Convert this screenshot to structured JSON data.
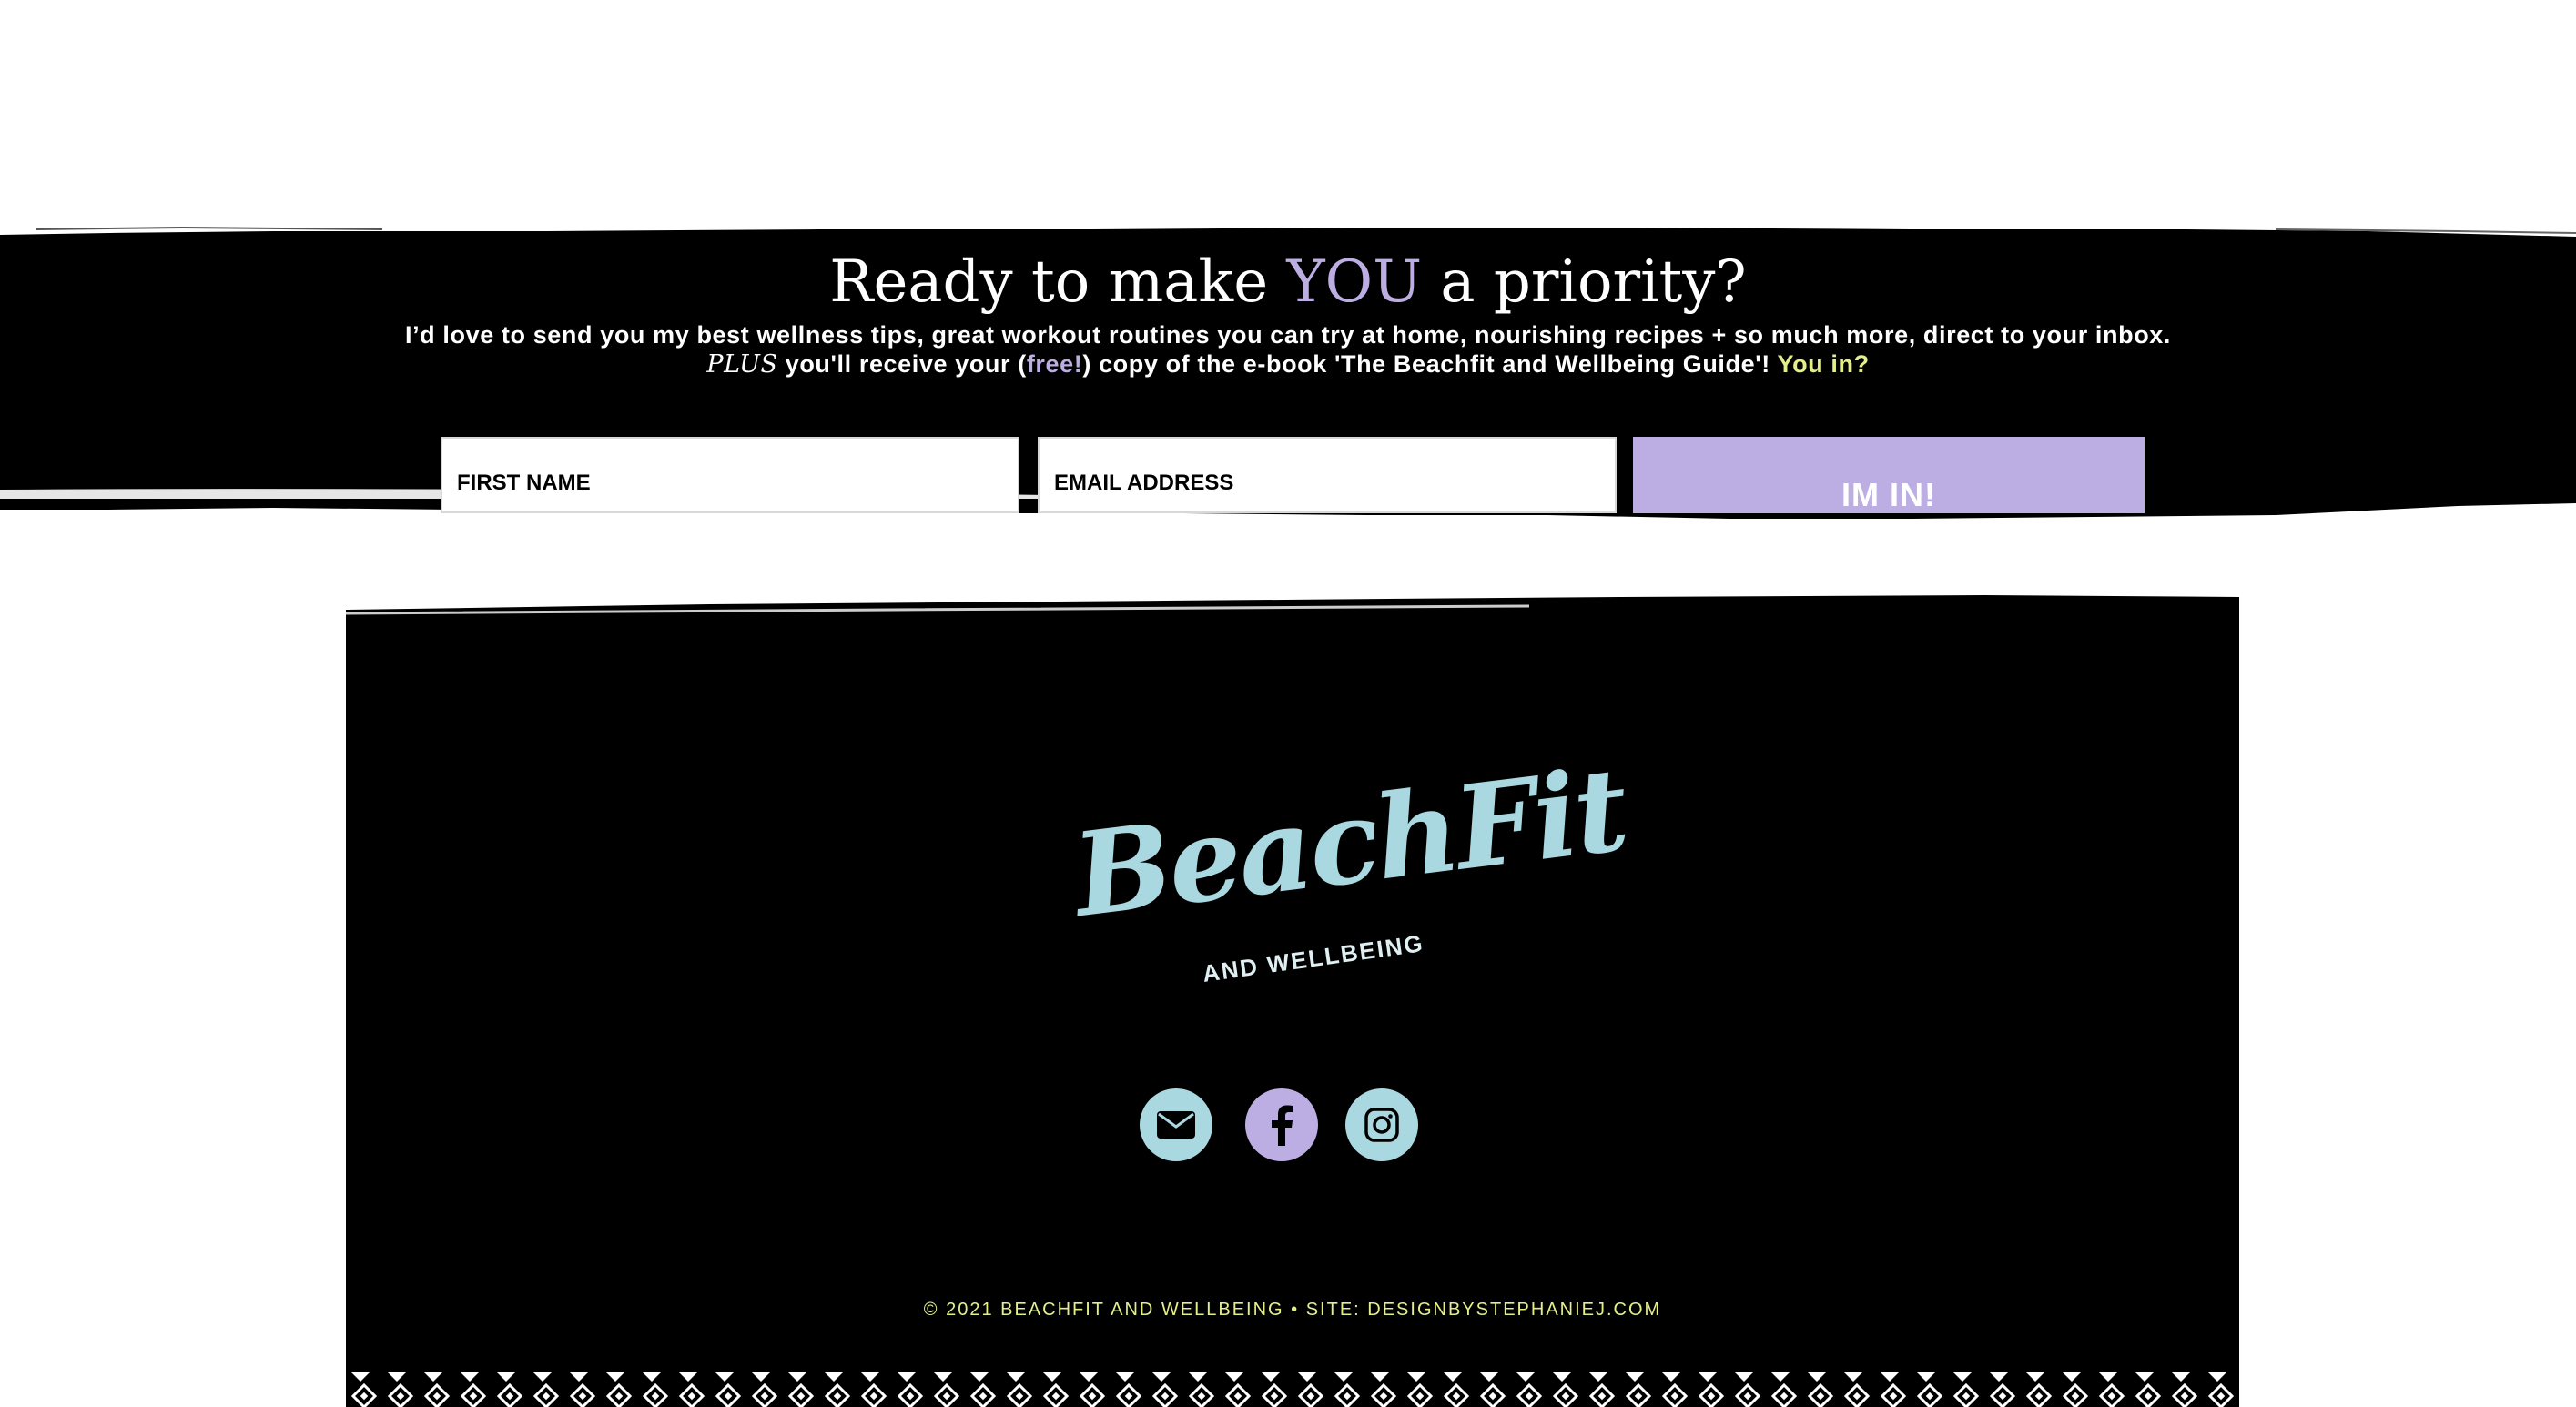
{
  "signup": {
    "headline_pre": "Ready to make ",
    "headline_accent": "YOU",
    "headline_post": " a priority?",
    "line1": "I’d love to send you my best wellness tips, great workout routines you can try at home, nourishing recipes + so much more, direct to your inbox.",
    "line2_plus": "PLUS",
    "line2_a": " you'll receive your (",
    "line2_free": "free!",
    "line2_b": ") copy of the e-book 'The Beachfit and Wellbeing Guide'! ",
    "line2_youin": "You in?",
    "first_name_placeholder": "FIRST NAME",
    "email_placeholder": "EMAIL ADDRESS",
    "submit_label": "IM IN!"
  },
  "footer": {
    "logo_script": "BeachFit",
    "logo_tagline": "AND WELLBEING",
    "social_icons": [
      "envelope-icon",
      "facebook-icon",
      "instagram-icon"
    ],
    "copyright": "© 2021 BEACHFIT AND WELLBEING • SITE: DESIGNBYSTEPHANIEJ.COM"
  },
  "colors": {
    "accent_lavender": "#bcaee3",
    "accent_aqua": "#a9d8e0",
    "accent_yellow": "#e4ef8c",
    "background_dark": "#000000"
  }
}
